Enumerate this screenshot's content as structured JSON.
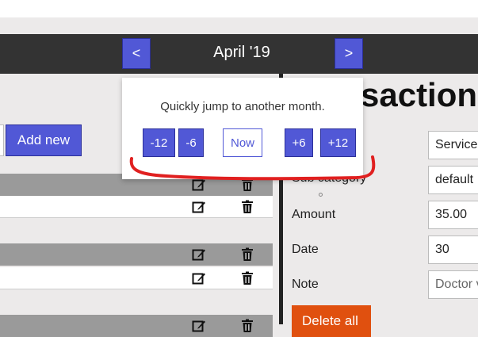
{
  "header": {
    "prev_label": "<",
    "next_label": ">",
    "month": "April '19"
  },
  "left": {
    "add_new_label": "Add new",
    "rows": [
      {
        "shade": "grey"
      },
      {
        "shade": "white"
      },
      {
        "shade": "grey"
      },
      {
        "shade": "white"
      },
      {
        "shade": "grey"
      }
    ]
  },
  "right": {
    "title_fragment": "saction",
    "obscured_label_fragment": "Sub category",
    "fields": [
      {
        "label": "",
        "value": "Service"
      },
      {
        "label": "",
        "value": "default"
      },
      {
        "label": "Amount",
        "value": "35.00"
      },
      {
        "label": "Date",
        "value": "30"
      },
      {
        "label": "Note",
        "value": "Doctor v"
      }
    ],
    "delete_all_label": "Delete all"
  },
  "popup": {
    "text": "Quickly jump to another month.",
    "buttons": [
      {
        "label": "-12"
      },
      {
        "label": "-6"
      },
      {
        "label": "Now"
      },
      {
        "label": "+6"
      },
      {
        "label": "+12"
      }
    ]
  },
  "colors": {
    "accent": "#5158d6",
    "topbar": "#333333",
    "danger": "#e0500f",
    "annotation": "#e02020"
  }
}
